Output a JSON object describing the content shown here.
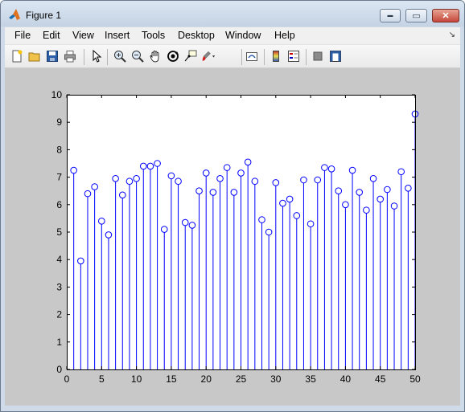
{
  "window": {
    "title": "Figure 1"
  },
  "window_buttons": {
    "minimize": "▬",
    "maximize": "▭",
    "close": "✕"
  },
  "menubar": {
    "items": [
      {
        "label": "File"
      },
      {
        "label": "Edit"
      },
      {
        "label": "View"
      },
      {
        "label": "Insert"
      },
      {
        "label": "Tools"
      },
      {
        "label": "Desktop"
      },
      {
        "label": "Window"
      },
      {
        "label": "Help"
      }
    ],
    "dock_arrow": "↘"
  },
  "toolbar": {
    "buttons": [
      "new-figure-icon",
      "open-file-icon",
      "save-icon",
      "print-icon",
      "edit-plot-pointer-icon",
      "zoom-in-icon",
      "zoom-out-icon",
      "pan-hand-icon",
      "rotate-3d-icon",
      "data-cursor-icon",
      "brush-icon",
      "link-plot-icon",
      "insert-colorbar-icon",
      "insert-legend-icon",
      "hide-plot-tools-icon",
      "show-plot-tools-icon"
    ]
  },
  "colors": {
    "stem": "#0000ff",
    "figure_bg": "#c8c8c8",
    "axes_bg": "#ffffff"
  },
  "chart_data": {
    "type": "stem",
    "x": [
      1,
      2,
      3,
      4,
      5,
      6,
      7,
      8,
      9,
      10,
      11,
      12,
      13,
      14,
      15,
      16,
      17,
      18,
      19,
      20,
      21,
      22,
      23,
      24,
      25,
      26,
      27,
      28,
      29,
      30,
      31,
      32,
      33,
      34,
      35,
      36,
      37,
      38,
      39,
      40,
      41,
      42,
      43,
      44,
      45,
      46,
      47,
      48,
      49,
      50
    ],
    "y": [
      7.25,
      3.95,
      6.4,
      6.65,
      5.4,
      4.9,
      6.95,
      6.35,
      6.85,
      6.95,
      7.4,
      7.4,
      7.5,
      5.1,
      7.05,
      6.85,
      5.35,
      5.25,
      6.5,
      7.15,
      6.45,
      6.95,
      7.35,
      6.45,
      7.15,
      7.55,
      6.85,
      5.45,
      5.0,
      6.8,
      6.05,
      6.2,
      5.6,
      6.9,
      5.3,
      6.9,
      7.35,
      7.3,
      6.5,
      6.0,
      7.25,
      6.45,
      5.8,
      6.95,
      6.2,
      6.55,
      5.95,
      7.2,
      6.6,
      9.3
    ],
    "xlim": [
      0,
      50
    ],
    "ylim": [
      0,
      10
    ],
    "xticks": [
      0,
      5,
      10,
      15,
      20,
      25,
      30,
      35,
      40,
      45,
      50
    ],
    "yticks": [
      0,
      1,
      2,
      3,
      4,
      5,
      6,
      7,
      8,
      9,
      10
    ],
    "grid": false,
    "title": "",
    "xlabel": "",
    "ylabel": ""
  }
}
